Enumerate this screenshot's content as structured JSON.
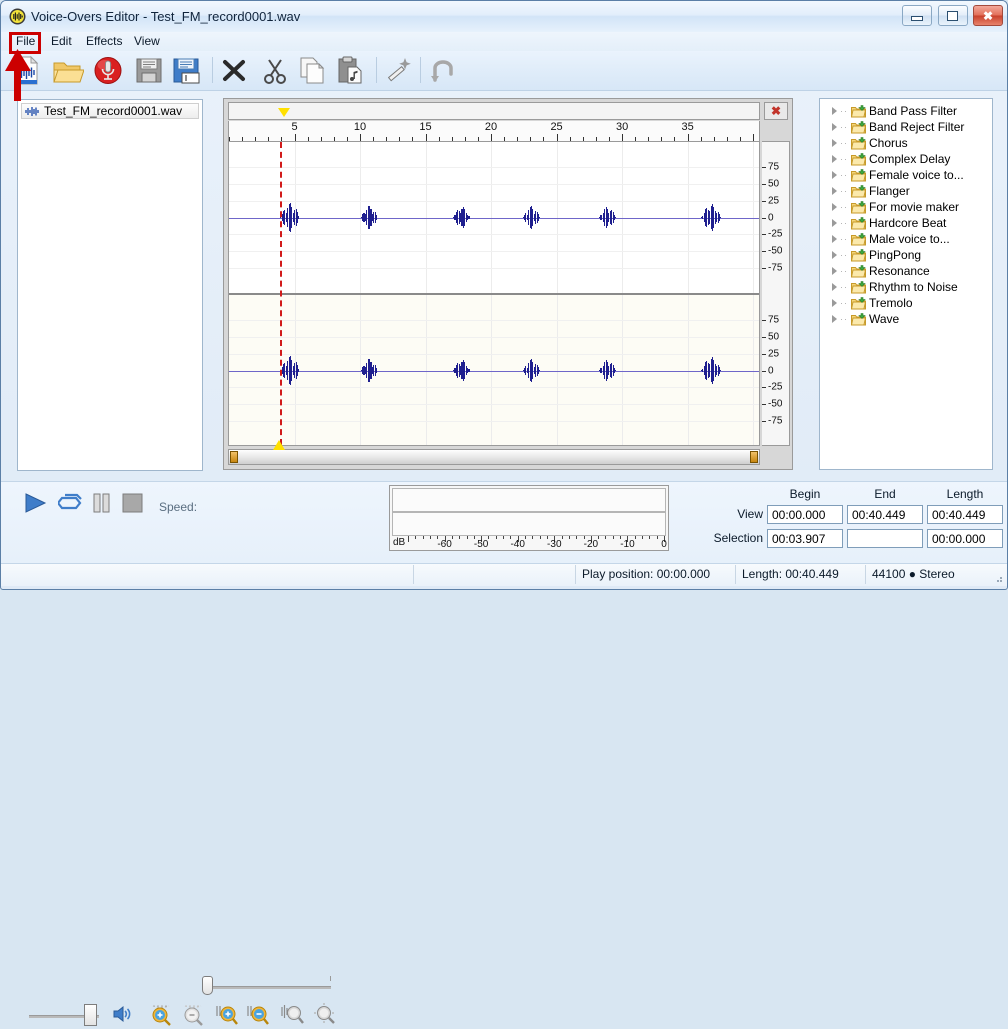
{
  "window": {
    "title": "Voice-Overs Editor - Test_FM_record0001.wav",
    "app_icon": "waveform-icon",
    "minimize_label": "",
    "maximize_label": "",
    "close_label": "✖"
  },
  "menu": {
    "items": [
      {
        "label": "File",
        "highlighted": true
      },
      {
        "label": "Edit",
        "highlighted": false
      },
      {
        "label": "Effects",
        "highlighted": false
      },
      {
        "label": "View",
        "highlighted": false
      }
    ]
  },
  "toolbar": {
    "buttons": [
      {
        "name": "new-file-icon",
        "title": "New"
      },
      {
        "name": "open-folder-icon",
        "title": "Open"
      },
      {
        "name": "record-icon",
        "title": "Record"
      },
      {
        "name": "save-icon",
        "title": "Save"
      },
      {
        "name": "save-as-icon",
        "title": "Save As"
      },
      {
        "name": "delete-icon",
        "title": "Delete"
      },
      {
        "name": "cut-icon",
        "title": "Cut"
      },
      {
        "name": "copy-icon",
        "title": "Copy"
      },
      {
        "name": "paste-icon",
        "title": "Paste"
      },
      {
        "name": "effects-wand-icon",
        "title": "Effects"
      },
      {
        "name": "undo-icon",
        "title": "Undo"
      }
    ]
  },
  "file_list": {
    "items": [
      {
        "label": "Test_FM_record0001.wav",
        "icon": "waveform-icon",
        "selected": true
      }
    ]
  },
  "waveform": {
    "close_label": "✖",
    "ruler": {
      "labels": [
        "5",
        "10",
        "15",
        "20",
        "25",
        "30",
        "35"
      ],
      "label_values": [
        5,
        10,
        15,
        20,
        25,
        30,
        35
      ],
      "max_seconds": 40.449,
      "minor_step": 1
    },
    "amplitude_scale": [
      "75",
      "50",
      "25",
      "0",
      "-25",
      "-50",
      "-75"
    ],
    "amplitude_values": [
      75,
      50,
      25,
      0,
      -25,
      -50,
      -75
    ],
    "channels": [
      "left",
      "right"
    ],
    "cursor_seconds": 3.907,
    "bursts": [
      {
        "start": 3.9,
        "end": 5.35,
        "peak": 22
      },
      {
        "start": 10.05,
        "end": 11.3,
        "peak": 18
      },
      {
        "start": 17.1,
        "end": 18.35,
        "peak": 16
      },
      {
        "start": 22.4,
        "end": 23.7,
        "peak": 17
      },
      {
        "start": 28.2,
        "end": 29.5,
        "peak": 16
      },
      {
        "start": 36.0,
        "end": 37.5,
        "peak": 20
      }
    ]
  },
  "effects_tree": {
    "items": [
      {
        "label": "Band Pass Filter",
        "icon": "folder-effect-icon"
      },
      {
        "label": "Band Reject Filter",
        "icon": "folder-effect-icon"
      },
      {
        "label": "Chorus",
        "icon": "folder-effect-icon"
      },
      {
        "label": "Complex Delay",
        "icon": "folder-effect-icon"
      },
      {
        "label": "Female voice to...",
        "icon": "folder-effect-icon"
      },
      {
        "label": "Flanger",
        "icon": "folder-effect-icon"
      },
      {
        "label": "For movie maker",
        "icon": "folder-effect-icon"
      },
      {
        "label": "Hardcore Beat",
        "icon": "folder-effect-icon"
      },
      {
        "label": "Male voice to...",
        "icon": "folder-effect-icon"
      },
      {
        "label": "PingPong",
        "icon": "folder-effect-icon"
      },
      {
        "label": "Resonance",
        "icon": "folder-effect-icon"
      },
      {
        "label": "Rhythm to Noise",
        "icon": "folder-effect-icon"
      },
      {
        "label": "Tremolo",
        "icon": "folder-effect-icon"
      },
      {
        "label": "Wave",
        "icon": "folder-effect-icon"
      }
    ]
  },
  "transport": {
    "play": "play-icon",
    "loop": "loop-icon",
    "pause": "pause-icon",
    "stop": "stop-icon",
    "speed_label": "Speed:",
    "speed_value": 0,
    "volume_value": 75,
    "speaker": "speaker-icon",
    "zoom_buttons": [
      {
        "name": "zoom-vertical-in-icon"
      },
      {
        "name": "zoom-vertical-out-icon"
      },
      {
        "name": "zoom-horizontal-in-icon"
      },
      {
        "name": "zoom-horizontal-out-icon"
      },
      {
        "name": "zoom-selection-icon"
      },
      {
        "name": "zoom-fit-icon"
      }
    ]
  },
  "meter": {
    "unit_label": "dB",
    "ticks": [
      "-60",
      "-50",
      "-40",
      "-30",
      "-20",
      "-10",
      "0"
    ],
    "tick_values": [
      -60,
      -50,
      -40,
      -30,
      -20,
      -10,
      0
    ],
    "range": [
      -70,
      0
    ]
  },
  "time_fields": {
    "headers": [
      "Begin",
      "End",
      "Length"
    ],
    "rows": [
      {
        "label": "View",
        "begin": "00:00.000",
        "end": "00:40.449",
        "length": "00:40.449"
      },
      {
        "label": "Selection",
        "begin": "00:03.907",
        "end": "",
        "length": "00:00.000"
      }
    ]
  },
  "status_bar": {
    "cells": [
      "",
      "",
      "Play position: 00:00.000",
      "Length: 00:40.449",
      "44100 ● Stereo"
    ]
  },
  "annotations": {
    "file_menu_highlight": "red-rectangle",
    "toolbar_arrow": "red-arrow-up"
  },
  "colors": {
    "accent": "#cc0000",
    "waveform": "#1f1f8f",
    "center_line": "#6f66c9",
    "cursor": "#d11a1a",
    "marker": "#ffe000"
  }
}
